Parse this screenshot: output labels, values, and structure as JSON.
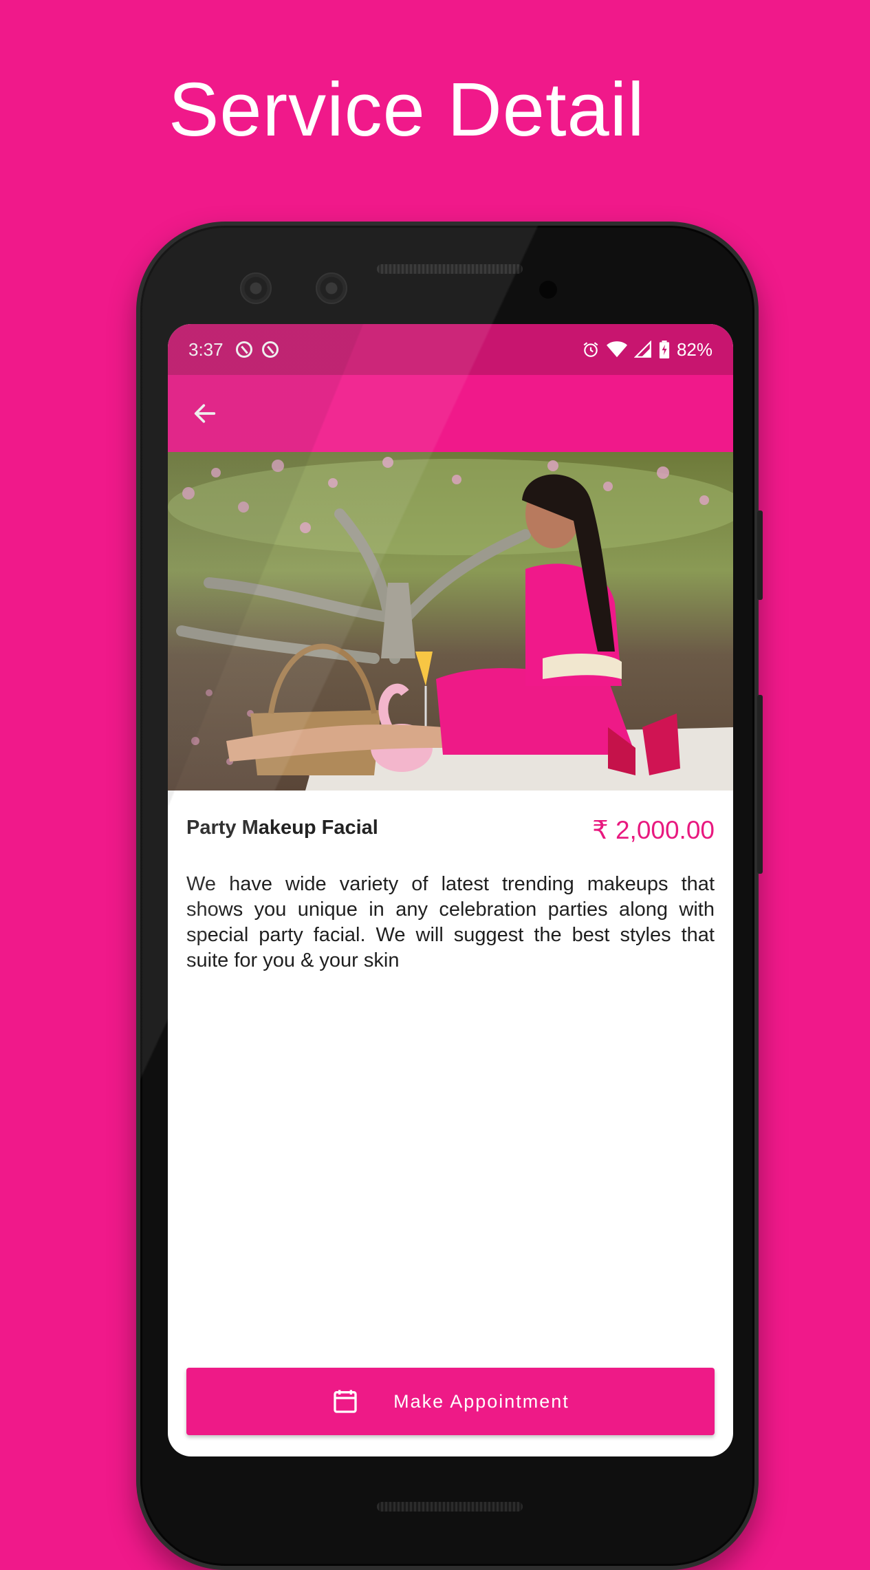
{
  "page": {
    "title": "Service Detail"
  },
  "status_bar": {
    "time": "3:37",
    "battery": "82%",
    "icons": [
      "notification-icon",
      "notification-icon",
      "alarm-icon",
      "wifi-icon",
      "signal-icon",
      "battery-icon"
    ]
  },
  "app_bar": {
    "back_icon": "arrow-left-icon"
  },
  "service": {
    "name": "Party Makeup Facial",
    "price": "₹ 2,000.00",
    "description": "We have wide variety of latest trending makeups that shows you unique in any celebration parties along with special party facial. We will suggest the best styles that suite for you & your skin"
  },
  "actions": {
    "make_appointment_label": "Make Appointment",
    "make_appointment_icon": "calendar-icon"
  },
  "colors": {
    "background": "#f0198a",
    "status_bar": "#c8156f",
    "accent": "#ee1a87",
    "price": "#e8197f"
  }
}
